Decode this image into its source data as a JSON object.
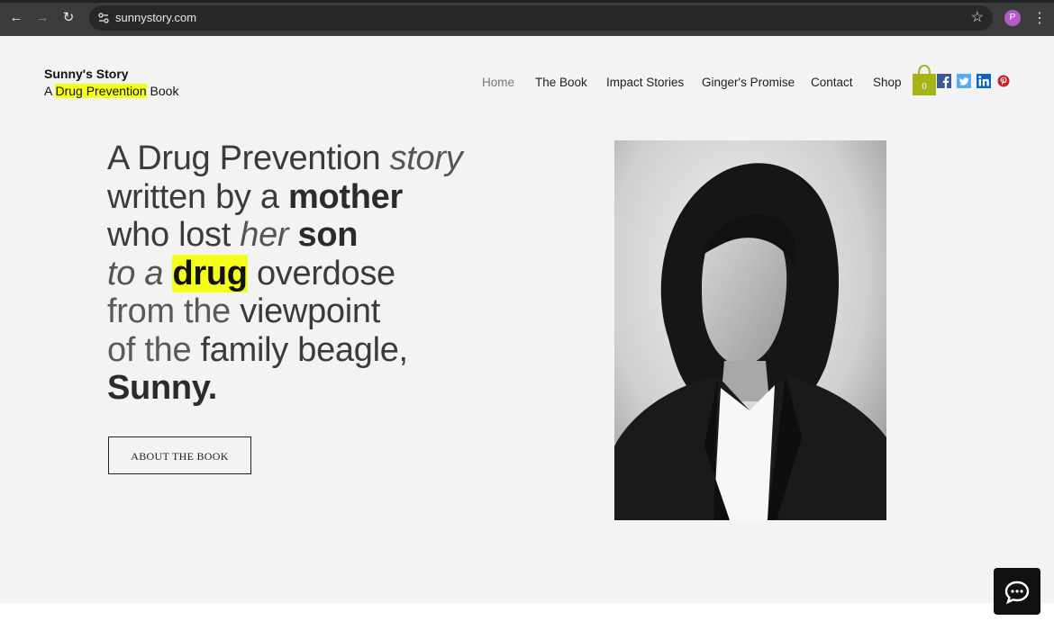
{
  "browser": {
    "url": "sunnystory.com",
    "profile_initial": "P"
  },
  "site": {
    "brand_title": "Sunny's Story",
    "brand_sub_prefix": "A ",
    "brand_sub_highlight": "Drug Prevention",
    "brand_sub_suffix": " Book",
    "highlight_color": "#f5ff1a"
  },
  "nav": {
    "items": [
      "Home",
      "The Book",
      "Impact Stories",
      "Ginger's Promise",
      "Contact",
      "Shop"
    ],
    "active": "Home",
    "cart_count": "0",
    "cart_color": "#a6b417"
  },
  "social": [
    "facebook-icon",
    "twitter-icon",
    "linkedin-icon",
    "pinterest-icon"
  ],
  "hero": {
    "l1a": "A Drug Prevention ",
    "l1b": "story",
    "l2a": "written by a ",
    "l2b": "mother",
    "l3a": "who lost ",
    "l3b": "her",
    "l3c": " son",
    "l4a": "to a ",
    "l4b": "drug",
    "l4c": " overdose",
    "l5a": "from the ",
    "l5b": "viewpoint",
    "l6a": "of the ",
    "l6b": "family beagle,",
    "l7": "Sunny."
  },
  "cta": {
    "label": "ABOUT THE BOOK"
  }
}
